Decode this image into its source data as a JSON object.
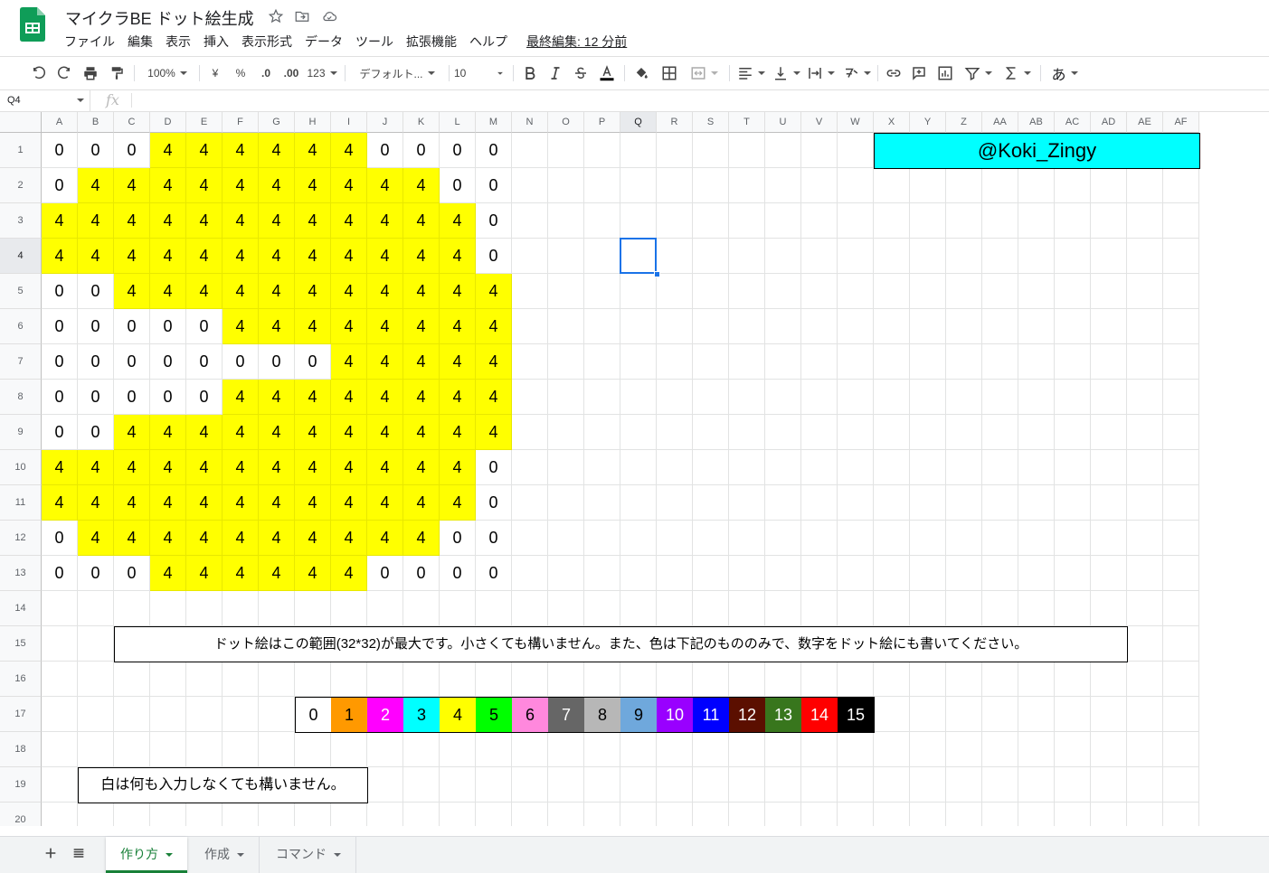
{
  "app": {
    "title": "マイクラBE ドット絵生成",
    "menu": [
      "ファイル",
      "編集",
      "表示",
      "挿入",
      "表示形式",
      "データ",
      "ツール",
      "拡張機能",
      "ヘルプ"
    ],
    "last_edit": "最終編集: 12 分前"
  },
  "toolbar": {
    "zoom": "100%",
    "currency": "¥",
    "percent": "%",
    "dec_decrease": ".0",
    "dec_increase": ".00",
    "more_formats": "123",
    "font": "デフォルト...",
    "font_size": "10",
    "input_tool": "あ"
  },
  "formula_bar": {
    "name_box": "Q4",
    "fx": "fx"
  },
  "columns": [
    "A",
    "B",
    "C",
    "D",
    "E",
    "F",
    "G",
    "H",
    "I",
    "J",
    "K",
    "L",
    "M",
    "N",
    "O",
    "P",
    "Q",
    "R",
    "S",
    "T",
    "U",
    "V",
    "W",
    "X",
    "Y",
    "Z",
    "AA",
    "AB",
    "AC",
    "AD",
    "AE",
    "AF"
  ],
  "rows": [
    "1",
    "2",
    "3",
    "4",
    "5",
    "6",
    "7",
    "8",
    "9",
    "10",
    "11",
    "12",
    "13",
    "14",
    "15",
    "16",
    "17",
    "18",
    "19",
    "20"
  ],
  "pixel_grid": [
    [
      "0",
      "0",
      "0",
      "4",
      "4",
      "4",
      "4",
      "4",
      "4",
      "0",
      "0",
      "0",
      "0"
    ],
    [
      "0",
      "4",
      "4",
      "4",
      "4",
      "4",
      "4",
      "4",
      "4",
      "4",
      "4",
      "0",
      "0"
    ],
    [
      "4",
      "4",
      "4",
      "4",
      "4",
      "4",
      "4",
      "4",
      "4",
      "4",
      "4",
      "4",
      "0"
    ],
    [
      "4",
      "4",
      "4",
      "4",
      "4",
      "4",
      "4",
      "4",
      "4",
      "4",
      "4",
      "4",
      "0"
    ],
    [
      "0",
      "0",
      "4",
      "4",
      "4",
      "4",
      "4",
      "4",
      "4",
      "4",
      "4",
      "4",
      "4"
    ],
    [
      "0",
      "0",
      "0",
      "0",
      "0",
      "4",
      "4",
      "4",
      "4",
      "4",
      "4",
      "4",
      "4"
    ],
    [
      "0",
      "0",
      "0",
      "0",
      "0",
      "0",
      "0",
      "0",
      "4",
      "4",
      "4",
      "4",
      "4"
    ],
    [
      "0",
      "0",
      "0",
      "0",
      "0",
      "4",
      "4",
      "4",
      "4",
      "4",
      "4",
      "4",
      "4"
    ],
    [
      "0",
      "0",
      "4",
      "4",
      "4",
      "4",
      "4",
      "4",
      "4",
      "4",
      "4",
      "4",
      "4"
    ],
    [
      "4",
      "4",
      "4",
      "4",
      "4",
      "4",
      "4",
      "4",
      "4",
      "4",
      "4",
      "4",
      "0"
    ],
    [
      "4",
      "4",
      "4",
      "4",
      "4",
      "4",
      "4",
      "4",
      "4",
      "4",
      "4",
      "4",
      "0"
    ],
    [
      "0",
      "4",
      "4",
      "4",
      "4",
      "4",
      "4",
      "4",
      "4",
      "4",
      "4",
      "0",
      "0"
    ],
    [
      "0",
      "0",
      "0",
      "4",
      "4",
      "4",
      "4",
      "4",
      "4",
      "0",
      "0",
      "0",
      "0"
    ]
  ],
  "pixel_color_4": "#ffff00",
  "author_tag": {
    "text": "@Koki_Zingy",
    "bg": "#00ffff"
  },
  "note_range": "ドット絵はこの範囲(32*32)が最大です。小さくても構いません。また、色は下記のもののみで、数字をドット絵にも書いてください。",
  "palette": [
    {
      "label": "0",
      "bg": "#ffffff",
      "fg": "#000000"
    },
    {
      "label": "1",
      "bg": "#ff9900",
      "fg": "#000000"
    },
    {
      "label": "2",
      "bg": "#ff00ff",
      "fg": "#ffffff"
    },
    {
      "label": "3",
      "bg": "#00ffff",
      "fg": "#000000"
    },
    {
      "label": "4",
      "bg": "#ffff00",
      "fg": "#000000"
    },
    {
      "label": "5",
      "bg": "#00ff00",
      "fg": "#000000"
    },
    {
      "label": "6",
      "bg": "#ff88dd",
      "fg": "#000000"
    },
    {
      "label": "7",
      "bg": "#666666",
      "fg": "#ffffff"
    },
    {
      "label": "8",
      "bg": "#b7b7b7",
      "fg": "#000000"
    },
    {
      "label": "9",
      "bg": "#6fa8dc",
      "fg": "#000000"
    },
    {
      "label": "10",
      "bg": "#9900ff",
      "fg": "#ffffff"
    },
    {
      "label": "11",
      "bg": "#0000ff",
      "fg": "#ffffff"
    },
    {
      "label": "12",
      "bg": "#5b0f00",
      "fg": "#ffffff"
    },
    {
      "label": "13",
      "bg": "#38761d",
      "fg": "#ffffff"
    },
    {
      "label": "14",
      "bg": "#ff0000",
      "fg": "#ffffff"
    },
    {
      "label": "15",
      "bg": "#000000",
      "fg": "#ffffff"
    }
  ],
  "note_white": "白は何も入力しなくても構いません。",
  "selected_cell": "Q4",
  "sheets": [
    {
      "name": "作り方",
      "active": true
    },
    {
      "name": "作成",
      "active": false
    },
    {
      "name": "コマンド",
      "active": false
    }
  ]
}
